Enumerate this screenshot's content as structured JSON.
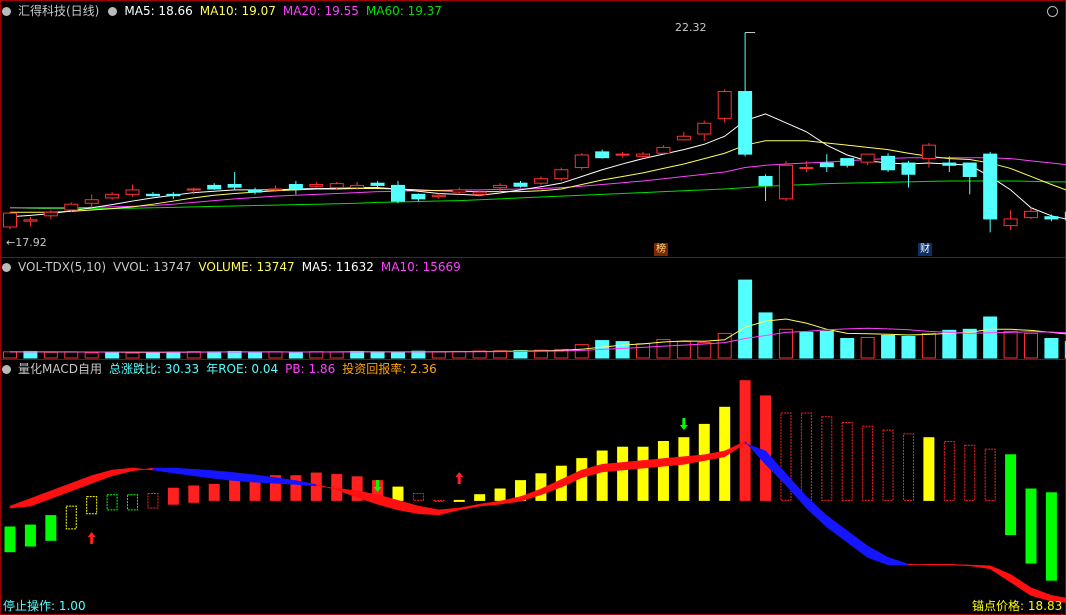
{
  "colors": {
    "up": "#ff3030",
    "down": "#54ffff",
    "ma5": "#ffffff",
    "ma10": "#ffff55",
    "ma20": "#ff40ff",
    "ma60": "#00e000",
    "grid": "#a00000",
    "text": "#c8c8c8",
    "label_yellow": "#ffff00",
    "label_cyan": "#54ffff",
    "label_orange": "#ffa500"
  },
  "price_panel": {
    "title": "汇得科技(日线)",
    "icon": "collapse-circle-icon",
    "ma5": "MA5: 18.66",
    "ma10": "MA10: 19.07",
    "ma20": "MA20: 19.55",
    "ma60": "MA60: 19.37",
    "high_label": "22.32",
    "low_label": "←17.92",
    "event_markers": [
      "榜",
      "财"
    ],
    "corner_icon": "circle-icon"
  },
  "volume_panel": {
    "title": "VOL-TDX(5,10)",
    "vvol": "VVOL: 13747",
    "volume": "VOLUME: 13747",
    "ma5": "MA5: 11632",
    "ma10": "MA10: 15669"
  },
  "indicator_panel": {
    "title": "量化MACD自用",
    "total_change": "总涨跌比: 30.33",
    "roe": "年ROE: 0.04",
    "pb": "PB: 1.86",
    "return_rate": "投资回报率: 2.36",
    "stop_op": "停止操作: 1.00",
    "anchor_price": "锚点价格: 18.83"
  },
  "chart_data": {
    "type": "candlestick",
    "ylim": [
      17.5,
      22.6
    ],
    "candles": [
      [
        17.97,
        18.28,
        17.92,
        18.31
      ],
      [
        18.1,
        18.13,
        17.98,
        18.2
      ],
      [
        18.22,
        18.3,
        18.15,
        18.35
      ],
      [
        18.35,
        18.48,
        18.3,
        18.52
      ],
      [
        18.5,
        18.58,
        18.4,
        18.7
      ],
      [
        18.62,
        18.7,
        18.58,
        18.75
      ],
      [
        18.7,
        18.8,
        18.65,
        18.92
      ],
      [
        18.7,
        18.67,
        18.65,
        18.75
      ],
      [
        18.7,
        18.67,
        18.6,
        18.75
      ],
      [
        18.8,
        18.82,
        18.7,
        18.85
      ],
      [
        18.9,
        18.82,
        18.8,
        18.95
      ],
      [
        18.92,
        18.86,
        18.8,
        19.2
      ],
      [
        18.8,
        18.75,
        18.7,
        18.85
      ],
      [
        18.8,
        18.82,
        18.75,
        18.9
      ],
      [
        18.92,
        18.82,
        18.7,
        19.0
      ],
      [
        18.88,
        18.92,
        18.85,
        18.98
      ],
      [
        18.85,
        18.94,
        18.8,
        18.98
      ],
      [
        18.85,
        18.9,
        18.8,
        18.98
      ],
      [
        18.95,
        18.9,
        18.85,
        19.0
      ],
      [
        18.9,
        18.55,
        18.5,
        19.0
      ],
      [
        18.7,
        18.6,
        18.55,
        18.72
      ],
      [
        18.65,
        18.68,
        18.6,
        18.72
      ],
      [
        18.75,
        18.8,
        18.7,
        18.85
      ],
      [
        18.7,
        18.75,
        18.65,
        18.78
      ],
      [
        18.85,
        18.9,
        18.75,
        18.95
      ],
      [
        18.95,
        18.88,
        18.85,
        19.0
      ],
      [
        18.95,
        19.05,
        18.9,
        19.1
      ],
      [
        19.05,
        19.25,
        19.0,
        19.3
      ],
      [
        19.3,
        19.58,
        19.25,
        19.62
      ],
      [
        19.65,
        19.52,
        19.5,
        19.7
      ],
      [
        19.58,
        19.6,
        19.52,
        19.65
      ],
      [
        19.55,
        19.6,
        19.5,
        19.65
      ],
      [
        19.62,
        19.75,
        19.6,
        19.8
      ],
      [
        19.92,
        20.0,
        19.9,
        20.1
      ],
      [
        20.05,
        20.29,
        19.9,
        20.35
      ],
      [
        20.4,
        21.0,
        20.3,
        21.05
      ],
      [
        21.0,
        19.6,
        19.55,
        22.32
      ],
      [
        19.1,
        18.9,
        18.55,
        19.15
      ],
      [
        18.6,
        19.35,
        18.55,
        19.45
      ],
      [
        19.3,
        19.3,
        19.2,
        19.45
      ],
      [
        19.4,
        19.32,
        19.2,
        19.6
      ],
      [
        19.5,
        19.35,
        19.3,
        19.5
      ],
      [
        19.42,
        19.6,
        19.35,
        19.6
      ],
      [
        19.55,
        19.25,
        19.2,
        19.62
      ],
      [
        19.4,
        19.15,
        18.85,
        19.45
      ],
      [
        19.5,
        19.8,
        19.3,
        19.85
      ],
      [
        19.4,
        19.35,
        19.2,
        19.55
      ],
      [
        19.4,
        19.1,
        18.7,
        19.4
      ],
      [
        19.6,
        18.15,
        17.85,
        19.65
      ],
      [
        18.0,
        18.15,
        17.9,
        18.35
      ],
      [
        18.18,
        18.32,
        18.15,
        18.4
      ],
      [
        18.2,
        18.15,
        18.1,
        18.25
      ],
      [
        18.3,
        18.13,
        18.1,
        18.35
      ],
      [
        18.26,
        18.83,
        18.05,
        18.85
      ]
    ],
    "ma5": [
      18.2,
      18.23,
      18.27,
      18.33,
      18.4,
      18.47,
      18.55,
      18.62,
      18.68,
      18.74,
      18.77,
      18.8,
      18.8,
      18.8,
      18.82,
      18.83,
      18.83,
      18.85,
      18.85,
      18.82,
      18.77,
      18.72,
      18.7,
      18.68,
      18.73,
      18.8,
      18.87,
      18.95,
      19.1,
      19.25,
      19.38,
      19.5,
      19.6,
      19.7,
      19.82,
      20.0,
      20.35,
      20.5,
      20.3,
      20.1,
      19.8,
      19.58,
      19.45,
      19.4,
      19.38,
      19.4,
      19.38,
      19.35,
      19.1,
      18.8,
      18.4,
      18.22,
      18.12,
      18.2
    ],
    "ma10": [
      18.3,
      18.3,
      18.3,
      18.32,
      18.35,
      18.38,
      18.42,
      18.48,
      18.55,
      18.62,
      18.68,
      18.72,
      18.75,
      18.78,
      18.8,
      18.82,
      18.82,
      18.83,
      18.83,
      18.82,
      18.8,
      18.78,
      18.77,
      18.76,
      18.76,
      18.76,
      18.78,
      18.82,
      18.92,
      19.02,
      19.1,
      19.18,
      19.28,
      19.38,
      19.5,
      19.62,
      19.8,
      19.9,
      19.9,
      19.9,
      19.85,
      19.8,
      19.75,
      19.7,
      19.62,
      19.55,
      19.5,
      19.48,
      19.4,
      19.28,
      19.1,
      18.92,
      18.75,
      18.55
    ],
    "ma20": [
      18.4,
      18.4,
      18.4,
      18.4,
      18.41,
      18.42,
      18.43,
      18.45,
      18.48,
      18.52,
      18.56,
      18.6,
      18.63,
      18.66,
      18.68,
      18.7,
      18.72,
      18.74,
      18.76,
      18.77,
      18.78,
      18.79,
      18.8,
      18.8,
      18.81,
      18.82,
      18.83,
      18.85,
      18.88,
      18.92,
      18.96,
      19.0,
      19.05,
      19.1,
      19.15,
      19.2,
      19.3,
      19.35,
      19.38,
      19.4,
      19.42,
      19.45,
      19.48,
      19.5,
      19.52,
      19.52,
      19.52,
      19.52,
      19.52,
      19.5,
      19.45,
      19.4,
      19.35,
      19.3
    ],
    "ma60": [
      18.4,
      18.39,
      18.38,
      18.38,
      18.38,
      18.38,
      18.39,
      18.4,
      18.41,
      18.42,
      18.43,
      18.44,
      18.45,
      18.46,
      18.47,
      18.48,
      18.49,
      18.5,
      18.52,
      18.53,
      18.54,
      18.55,
      18.56,
      18.58,
      18.6,
      18.62,
      18.64,
      18.66,
      18.68,
      18.7,
      18.72,
      18.74,
      18.76,
      18.78,
      18.8,
      18.82,
      18.85,
      18.88,
      18.9,
      18.92,
      18.94,
      18.95,
      18.96,
      18.97,
      18.98,
      18.99,
      19.0,
      19.0,
      19.0,
      19.0,
      18.99,
      18.98,
      18.98,
      18.97
    ],
    "volume": [
      3000,
      3200,
      2800,
      3000,
      2500,
      2800,
      2400,
      2600,
      2900,
      3100,
      3000,
      3200,
      2800,
      3000,
      2700,
      3100,
      2900,
      3200,
      3000,
      2800,
      3300,
      3000,
      3200,
      3400,
      3500,
      3600,
      3800,
      4200,
      6500,
      8500,
      8000,
      7000,
      9000,
      8000,
      7500,
      12000,
      38000,
      22000,
      14000,
      12500,
      13000,
      9500,
      10000,
      11000,
      10500,
      12000,
      13500,
      14000,
      20000,
      13000,
      12000,
      9500,
      8000,
      13747
    ],
    "volume_up": [
      1,
      0,
      1,
      1,
      1,
      0,
      1,
      0,
      0,
      1,
      0,
      0,
      0,
      1,
      0,
      1,
      1,
      0,
      0,
      0,
      0,
      1,
      1,
      1,
      1,
      0,
      1,
      1,
      1,
      0,
      0,
      1,
      1,
      1,
      1,
      1,
      0,
      0,
      1,
      0,
      0,
      0,
      1,
      0,
      0,
      1,
      0,
      0,
      0,
      1,
      1,
      0,
      0,
      1
    ],
    "vol_ma5": [
      3000,
      3000,
      3000,
      2950,
      2900,
      2850,
      2800,
      2750,
      2800,
      2850,
      2950,
      3000,
      3000,
      3000,
      2950,
      2950,
      3000,
      3050,
      3000,
      3000,
      3000,
      3050,
      3100,
      3150,
      3250,
      3350,
      3500,
      3700,
      4300,
      5300,
      6300,
      6900,
      7800,
      8300,
      8200,
      8900,
      15000,
      18000,
      19000,
      17000,
      14000,
      12000,
      11800,
      11600,
      11200,
      11500,
      12000,
      12500,
      14000,
      14000,
      13500,
      12500,
      11500,
      11632
    ],
    "vol_ma10": [
      3000,
      3000,
      3000,
      3000,
      2950,
      2900,
      2900,
      2850,
      2850,
      2850,
      2900,
      2950,
      2950,
      2950,
      2950,
      2950,
      2950,
      3000,
      3000,
      3000,
      3000,
      3000,
      3050,
      3050,
      3100,
      3200,
      3300,
      3400,
      3700,
      4200,
      4700,
      5200,
      5800,
      6300,
      6800,
      7500,
      9500,
      11000,
      12500,
      13000,
      13800,
      14200,
      14500,
      14200,
      13800,
      13000,
      12500,
      12000,
      12300,
      12500,
      12800,
      12600,
      12200,
      15669
    ],
    "macd_top": [
      0.05,
      0.25,
      0.45,
      0.65,
      0.85,
      1.0,
      1.05,
      1.0,
      0.92,
      0.85,
      0.78,
      0.72,
      0.68,
      0.65,
      0.62,
      0.58,
      0.52,
      0.45,
      0.35,
      0.2,
      0.05,
      -0.05,
      0.0,
      0.1,
      0.18,
      0.3,
      0.5,
      0.75,
      1.0,
      1.15,
      1.2,
      1.25,
      1.3,
      1.35,
      1.4,
      1.5,
      1.75,
      1.15,
      0.6,
      0.0,
      -0.5,
      -0.9,
      -1.3,
      -1.5,
      -1.5,
      -1.48,
      -1.48,
      -1.5,
      -1.52,
      -1.75,
      -2.1,
      -2.3,
      -2.4,
      -2.5
    ],
    "macd_bot": [
      0.0,
      0.05,
      0.25,
      0.45,
      0.65,
      0.85,
      0.98,
      1.05,
      1.05,
      1.02,
      0.98,
      0.93,
      0.87,
      0.8,
      0.72,
      0.62,
      0.48,
      0.28,
      0.1,
      -0.05,
      -0.15,
      -0.18,
      -0.05,
      0.05,
      0.1,
      0.18,
      0.35,
      0.55,
      0.8,
      0.95,
      1.0,
      1.05,
      1.1,
      1.15,
      1.25,
      1.35,
      1.7,
      1.5,
      0.9,
      0.3,
      -0.2,
      -0.6,
      -1.0,
      -1.3,
      -1.48,
      -1.5,
      -1.5,
      -1.52,
      -1.6,
      -1.95,
      -2.3,
      -2.45,
      -2.5,
      -2.1
    ],
    "hist_top": [
      -0.5,
      -0.45,
      -0.2,
      0.05,
      0.3,
      0.35,
      0.35,
      0.38,
      0.52,
      0.58,
      0.62,
      0.72,
      0.8,
      0.85,
      0.85,
      0.92,
      0.88,
      0.82,
      0.72,
      0.55,
      0.38,
      0.2,
      0.2,
      0.35,
      0.5,
      0.72,
      0.9,
      1.1,
      1.3,
      1.5,
      1.6,
      1.6,
      1.75,
      1.85,
      2.2,
      2.65,
      3.35,
      2.95,
      2.5,
      2.5,
      2.4,
      2.25,
      2.15,
      2.05,
      1.95,
      1.85,
      1.75,
      1.65,
      1.55,
      1.4,
      0.5,
      0.4,
      0.5,
      0.5
    ],
    "hist_bot": [
      -1.15,
      -1.0,
      -0.85,
      -0.55,
      -0.15,
      -0.05,
      -0.05,
      0.0,
      0.1,
      0.15,
      0.2,
      0.2,
      0.2,
      0.2,
      0.2,
      0.2,
      0.2,
      0.2,
      0.2,
      0.2,
      0.2,
      0.2,
      0.2,
      0.2,
      0.2,
      0.2,
      0.2,
      0.2,
      0.2,
      0.2,
      0.2,
      0.2,
      0.2,
      0.2,
      0.2,
      0.2,
      0.2,
      0.2,
      0.2,
      0.2,
      0.2,
      0.2,
      0.2,
      0.2,
      0.2,
      0.2,
      0.2,
      0.2,
      0.2,
      -0.7,
      -1.45,
      -1.9,
      -2.3,
      -1.3
    ],
    "hist_style": [
      "gs",
      "gs",
      "gs",
      "yo",
      "yo",
      "go",
      "go",
      "ro",
      "rs",
      "rs",
      "rs",
      "rs",
      "rs",
      "rs",
      "rs",
      "rs",
      "rs",
      "rs",
      "rs",
      "ys",
      "ro",
      "ro",
      "ys",
      "ys",
      "ys",
      "ys",
      "ys",
      "ys",
      "ys",
      "ys",
      "ys",
      "ys",
      "ys",
      "ys",
      "ys",
      "ys",
      "rs",
      "rs",
      "ro",
      "ro",
      "ro",
      "ro",
      "ro",
      "ro",
      "ro",
      "ys",
      "ro",
      "ro",
      "ro",
      "gs",
      "gs",
      "gs",
      "gs",
      "gs"
    ],
    "signals_up": [
      4,
      22
    ],
    "signals_down": [
      18,
      33
    ]
  }
}
